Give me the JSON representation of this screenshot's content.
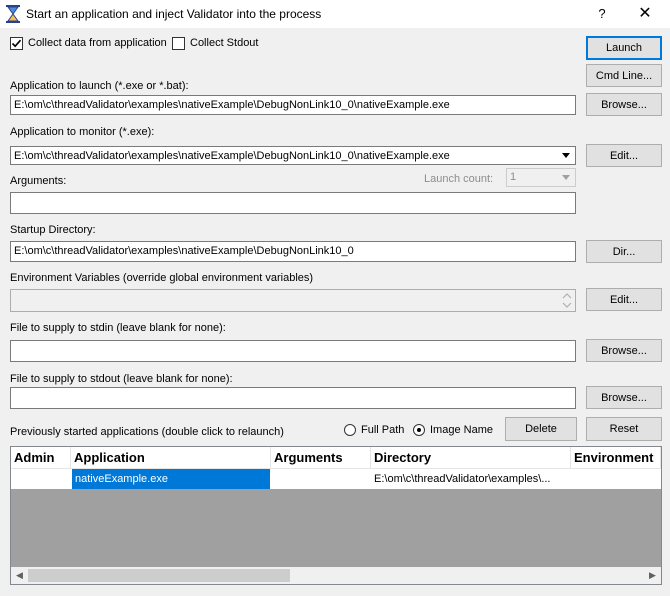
{
  "window": {
    "title": "Start an application and inject Validator into the process",
    "help": "?",
    "close": "✕"
  },
  "options": {
    "collect_data_label": "Collect data from application",
    "collect_data_checked": true,
    "collect_stdout_label": "Collect Stdout",
    "collect_stdout_checked": false
  },
  "buttons": {
    "launch": "Launch",
    "cmd_line": "Cmd Line...",
    "browse": "Browse...",
    "edit": "Edit...",
    "dir": "Dir...",
    "delete": "Delete",
    "reset": "Reset"
  },
  "app_to_launch": {
    "label": "Application to launch (*.exe or *.bat):",
    "value": "E:\\om\\c\\threadValidator\\examples\\nativeExample\\DebugNonLink10_0\\nativeExample.exe"
  },
  "app_to_monitor": {
    "label": "Application to monitor (*.exe):",
    "value": "E:\\om\\c\\threadValidator\\examples\\nativeExample\\DebugNonLink10_0\\nativeExample.exe"
  },
  "arguments": {
    "label": "Arguments:",
    "value": "",
    "launch_count_label": "Launch count:",
    "launch_count_value": "1"
  },
  "startup_dir": {
    "label": "Startup Directory:",
    "value": "E:\\om\\c\\threadValidator\\examples\\nativeExample\\DebugNonLink10_0"
  },
  "env_vars": {
    "label": "Environment Variables (override global environment variables)",
    "value": ""
  },
  "stdin": {
    "label": "File to supply to stdin (leave blank for none):",
    "value": ""
  },
  "stdout": {
    "label": "File to supply to stdout (leave blank for none):",
    "value": ""
  },
  "history": {
    "label": "Previously started applications (double click to relaunch)",
    "full_path_label": "Full Path",
    "image_name_label": "Image Name",
    "selected_view": "Image Name",
    "columns": [
      "Admin",
      "Application",
      "Arguments",
      "Directory",
      "Environment"
    ],
    "rows": [
      {
        "admin": "",
        "application": "nativeExample.exe",
        "arguments": "",
        "directory": "E:\\om\\c\\threadValidator\\examples\\...",
        "environment": ""
      }
    ]
  },
  "icons": {
    "app": "hourglass-icon",
    "dropdown": "chevron-down-icon",
    "spin_up": "spin-up-icon",
    "spin_down": "spin-down-icon",
    "scroll_left": "scroll-left-icon",
    "scroll_right": "scroll-right-icon"
  },
  "colors": {
    "selection": "#0078d7",
    "window_bg": "#f0f0f0",
    "table_empty_bg": "#a0a0a0"
  }
}
